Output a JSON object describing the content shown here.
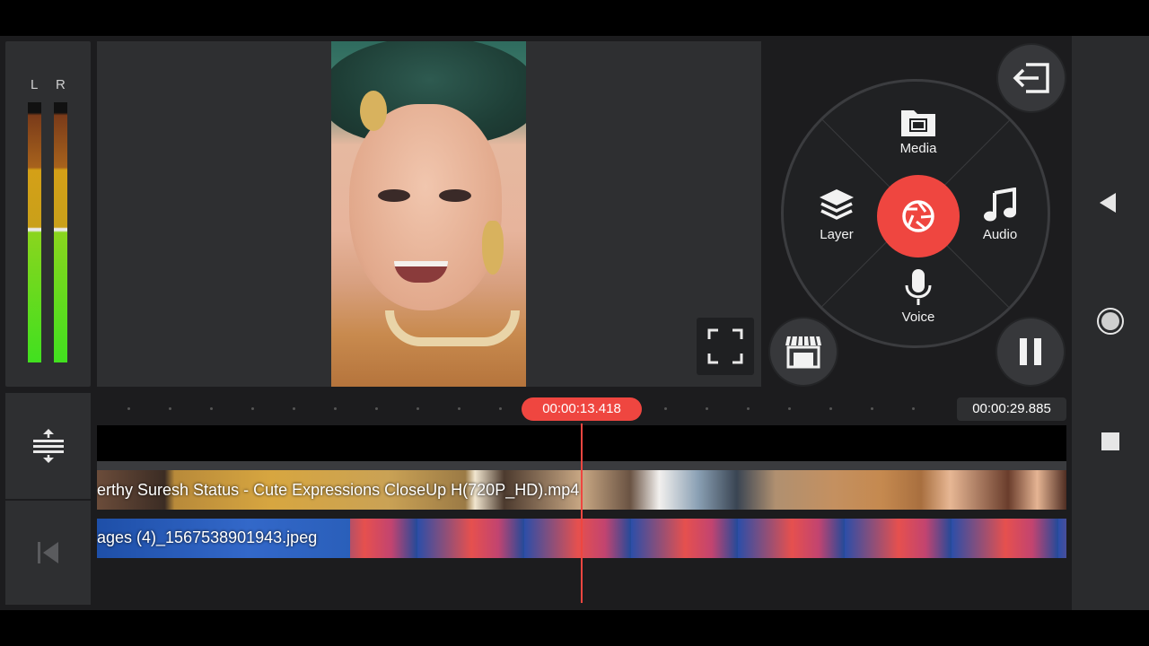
{
  "meter": {
    "left_label": "L",
    "right_label": "R"
  },
  "radial_menu": {
    "media_label": "Media",
    "layer_label": "Layer",
    "audio_label": "Audio",
    "voice_label": "Voice",
    "record_icon": "camera-shutter-icon",
    "record_color": "#ef4640"
  },
  "timeline": {
    "current_time": "00:00:13.418",
    "total_time": "00:00:29.885",
    "video_clip_label": "erthy Suresh Status - Cute Expressions CloseUp H(720P_HD).mp4",
    "image_clip_label": "ages (4)_1567538901943.jpeg"
  },
  "icons": {
    "exit": "exit-icon",
    "store": "asset-store-icon",
    "pause": "pause-icon",
    "fullscreen": "fullscreen-icon",
    "track_adjust": "track-height-icon",
    "rewind": "skip-to-start-icon"
  },
  "colors": {
    "accent": "#ef4640",
    "panel": "#2e2f31",
    "background": "#1c1c1e"
  }
}
